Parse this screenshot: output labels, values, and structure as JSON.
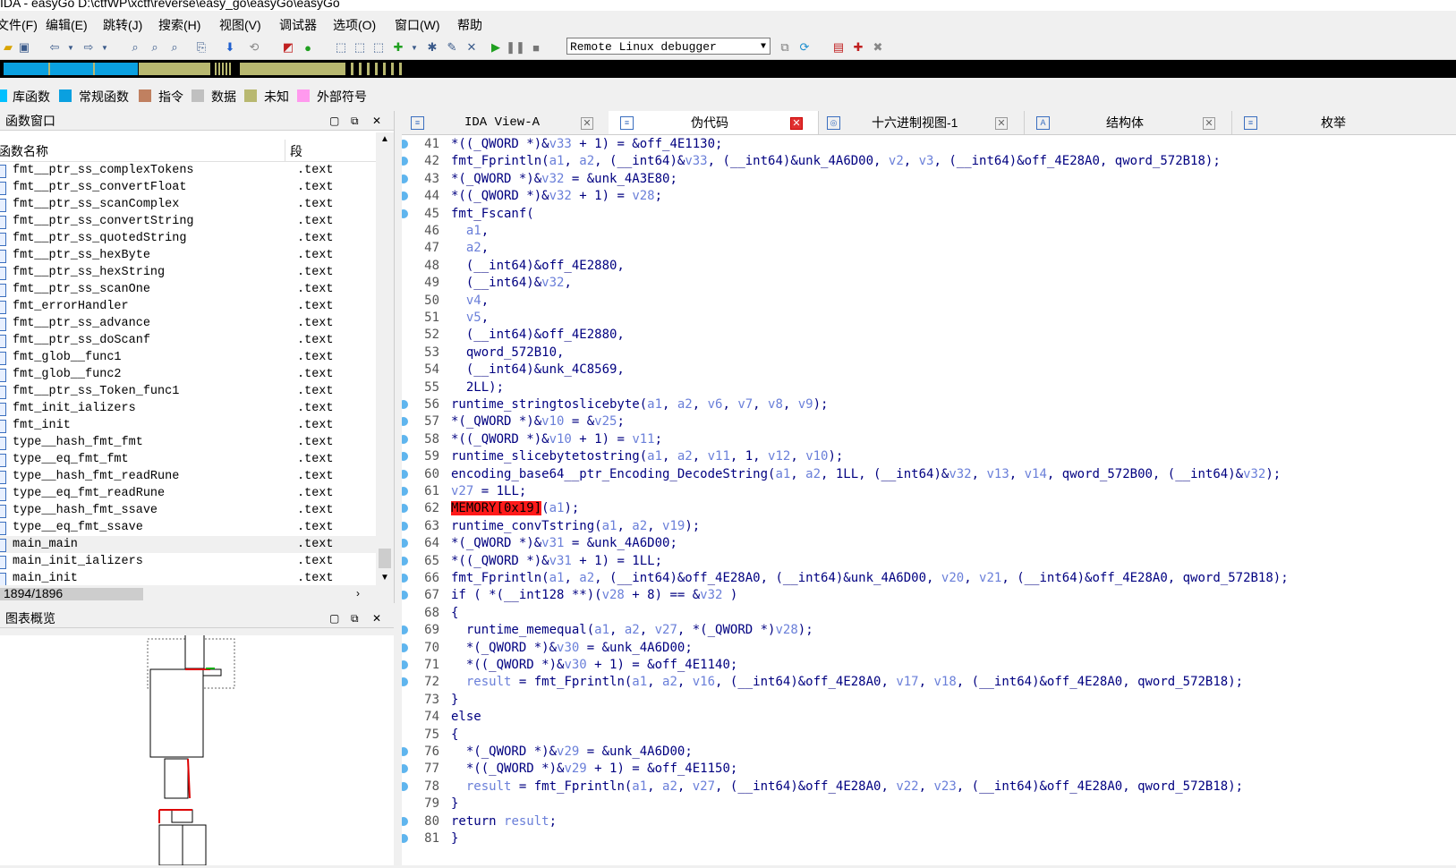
{
  "window": {
    "title": "IDA - easyGo D:\\ctfWP\\xctf\\reverse\\easy_go\\easyGo\\easyGo"
  },
  "menu": [
    "文件(F)",
    "编辑(E)",
    "跳转(J)",
    "搜索(H)",
    "视图(V)",
    "调试器",
    "选项(O)",
    "窗口(W)",
    "帮助"
  ],
  "toolbar": {
    "debugger": "Remote Linux debugger"
  },
  "legend": [
    {
      "label": "库函数",
      "color": "#00c0ff"
    },
    {
      "label": "常规函数",
      "color": "#0aa0e0"
    },
    {
      "label": "指令",
      "color": "#c08060"
    },
    {
      "label": "数据",
      "color": "#c0c0c0"
    },
    {
      "label": "未知",
      "color": "#b8b870"
    },
    {
      "label": "外部符号",
      "color": "#ff99ee"
    }
  ],
  "functions_panel": {
    "title": "函数窗口",
    "col_name": "函数名称",
    "col_segment": "段",
    "status": "1894/1896",
    "rows": [
      {
        "name": "fmt__ptr_ss_complexTokens",
        "seg": ".text"
      },
      {
        "name": "fmt__ptr_ss_convertFloat",
        "seg": ".text"
      },
      {
        "name": "fmt__ptr_ss_scanComplex",
        "seg": ".text"
      },
      {
        "name": "fmt__ptr_ss_convertString",
        "seg": ".text"
      },
      {
        "name": "fmt__ptr_ss_quotedString",
        "seg": ".text"
      },
      {
        "name": "fmt__ptr_ss_hexByte",
        "seg": ".text"
      },
      {
        "name": "fmt__ptr_ss_hexString",
        "seg": ".text"
      },
      {
        "name": "fmt__ptr_ss_scanOne",
        "seg": ".text"
      },
      {
        "name": "fmt_errorHandler",
        "seg": ".text"
      },
      {
        "name": "fmt__ptr_ss_advance",
        "seg": ".text"
      },
      {
        "name": "fmt__ptr_ss_doScanf",
        "seg": ".text"
      },
      {
        "name": "fmt_glob__func1",
        "seg": ".text"
      },
      {
        "name": "fmt_glob__func2",
        "seg": ".text"
      },
      {
        "name": "fmt__ptr_ss_Token_func1",
        "seg": ".text"
      },
      {
        "name": "fmt_init_ializers",
        "seg": ".text"
      },
      {
        "name": "fmt_init",
        "seg": ".text"
      },
      {
        "name": "type__hash_fmt_fmt",
        "seg": ".text"
      },
      {
        "name": "type__eq_fmt_fmt",
        "seg": ".text"
      },
      {
        "name": "type__hash_fmt_readRune",
        "seg": ".text"
      },
      {
        "name": "type__eq_fmt_readRune",
        "seg": ".text"
      },
      {
        "name": "type__hash_fmt_ssave",
        "seg": ".text"
      },
      {
        "name": "type__eq_fmt_ssave",
        "seg": ".text"
      },
      {
        "name": "main_main",
        "seg": ".text"
      },
      {
        "name": "main_init_ializers",
        "seg": ".text"
      },
      {
        "name": "main_init",
        "seg": ".text"
      }
    ]
  },
  "graph_panel": {
    "title": "图表概览"
  },
  "tabs": [
    {
      "label": "IDA View-A"
    },
    {
      "label": "伪代码"
    },
    {
      "label": "十六进制视图-1"
    },
    {
      "label": "结构体"
    },
    {
      "label": "枚举"
    }
  ],
  "code_lines": [
    {
      "n": "41",
      "bp": true,
      "t": "*((_QWORD *)&v33 + 1) = &off_4E1130;"
    },
    {
      "n": "42",
      "bp": true,
      "t": "fmt_Fprintln(a1, a2, (__int64)&v33, (__int64)&unk_4A6D00, v2, v3, (__int64)&off_4E28A0, qword_572B18);"
    },
    {
      "n": "43",
      "bp": true,
      "t": "*(_QWORD *)&v32 = &unk_4A3E80;"
    },
    {
      "n": "44",
      "bp": true,
      "t": "*((_QWORD *)&v32 + 1) = v28;"
    },
    {
      "n": "45",
      "bp": true,
      "t": "fmt_Fscanf("
    },
    {
      "n": "46",
      "bp": false,
      "t": "  a1,"
    },
    {
      "n": "47",
      "bp": false,
      "t": "  a2,"
    },
    {
      "n": "48",
      "bp": false,
      "t": "  (__int64)&off_4E2880,"
    },
    {
      "n": "49",
      "bp": false,
      "t": "  (__int64)&v32,"
    },
    {
      "n": "50",
      "bp": false,
      "t": "  v4,"
    },
    {
      "n": "51",
      "bp": false,
      "t": "  v5,"
    },
    {
      "n": "52",
      "bp": false,
      "t": "  (__int64)&off_4E2880,"
    },
    {
      "n": "53",
      "bp": false,
      "t": "  qword_572B10,"
    },
    {
      "n": "54",
      "bp": false,
      "t": "  (__int64)&unk_4C8569,"
    },
    {
      "n": "55",
      "bp": false,
      "t": "  2LL);"
    },
    {
      "n": "56",
      "bp": true,
      "t": "runtime_stringtoslicebyte(a1, a2, v6, v7, v8, v9);"
    },
    {
      "n": "57",
      "bp": true,
      "t": "*(_QWORD *)&v10 = &v25;"
    },
    {
      "n": "58",
      "bp": true,
      "t": "*((_QWORD *)&v10 + 1) = v11;"
    },
    {
      "n": "59",
      "bp": true,
      "t": "runtime_slicebytetostring(a1, a2, v11, 1, v12, v10);"
    },
    {
      "n": "60",
      "bp": true,
      "t": "encoding_base64__ptr_Encoding_DecodeString(a1, a2, 1LL, (__int64)&v32, v13, v14, qword_572B00, (__int64)&v32);"
    },
    {
      "n": "61",
      "bp": true,
      "t": "v27 = 1LL;"
    },
    {
      "n": "62",
      "bp": true,
      "t": "MEMORY[0x19](a1);"
    },
    {
      "n": "63",
      "bp": true,
      "t": "runtime_convTstring(a1, a2, v19);"
    },
    {
      "n": "64",
      "bp": true,
      "t": "*(_QWORD *)&v31 = &unk_4A6D00;"
    },
    {
      "n": "65",
      "bp": true,
      "t": "*((_QWORD *)&v31 + 1) = 1LL;"
    },
    {
      "n": "66",
      "bp": true,
      "t": "fmt_Fprintln(a1, a2, (__int64)&off_4E28A0, (__int64)&unk_4A6D00, v20, v21, (__int64)&off_4E28A0, qword_572B18);"
    },
    {
      "n": "67",
      "bp": true,
      "t": "if ( *(__int128 **)(v28 + 8) == &v32 )"
    },
    {
      "n": "68",
      "bp": false,
      "t": "{"
    },
    {
      "n": "69",
      "bp": true,
      "t": "  runtime_memequal(a1, a2, v27, *(_QWORD *)v28);"
    },
    {
      "n": "70",
      "bp": true,
      "t": "  *(_QWORD *)&v30 = &unk_4A6D00;"
    },
    {
      "n": "71",
      "bp": true,
      "t": "  *((_QWORD *)&v30 + 1) = &off_4E1140;"
    },
    {
      "n": "72",
      "bp": true,
      "t": "  result = fmt_Fprintln(a1, a2, v16, (__int64)&off_4E28A0, v17, v18, (__int64)&off_4E28A0, qword_572B18);"
    },
    {
      "n": "73",
      "bp": false,
      "t": "}"
    },
    {
      "n": "74",
      "bp": false,
      "t": "else"
    },
    {
      "n": "75",
      "bp": false,
      "t": "{"
    },
    {
      "n": "76",
      "bp": true,
      "t": "  *(_QWORD *)&v29 = &unk_4A6D00;"
    },
    {
      "n": "77",
      "bp": true,
      "t": "  *((_QWORD *)&v29 + 1) = &off_4E1150;"
    },
    {
      "n": "78",
      "bp": true,
      "t": "  result = fmt_Fprintln(a1, a2, v27, (__int64)&off_4E28A0, v22, v23, (__int64)&off_4E28A0, qword_572B18);"
    },
    {
      "n": "79",
      "bp": false,
      "t": "}"
    },
    {
      "n": "80",
      "bp": true,
      "t": "return result;"
    },
    {
      "n": "81",
      "bp": true,
      "t": "}"
    }
  ]
}
